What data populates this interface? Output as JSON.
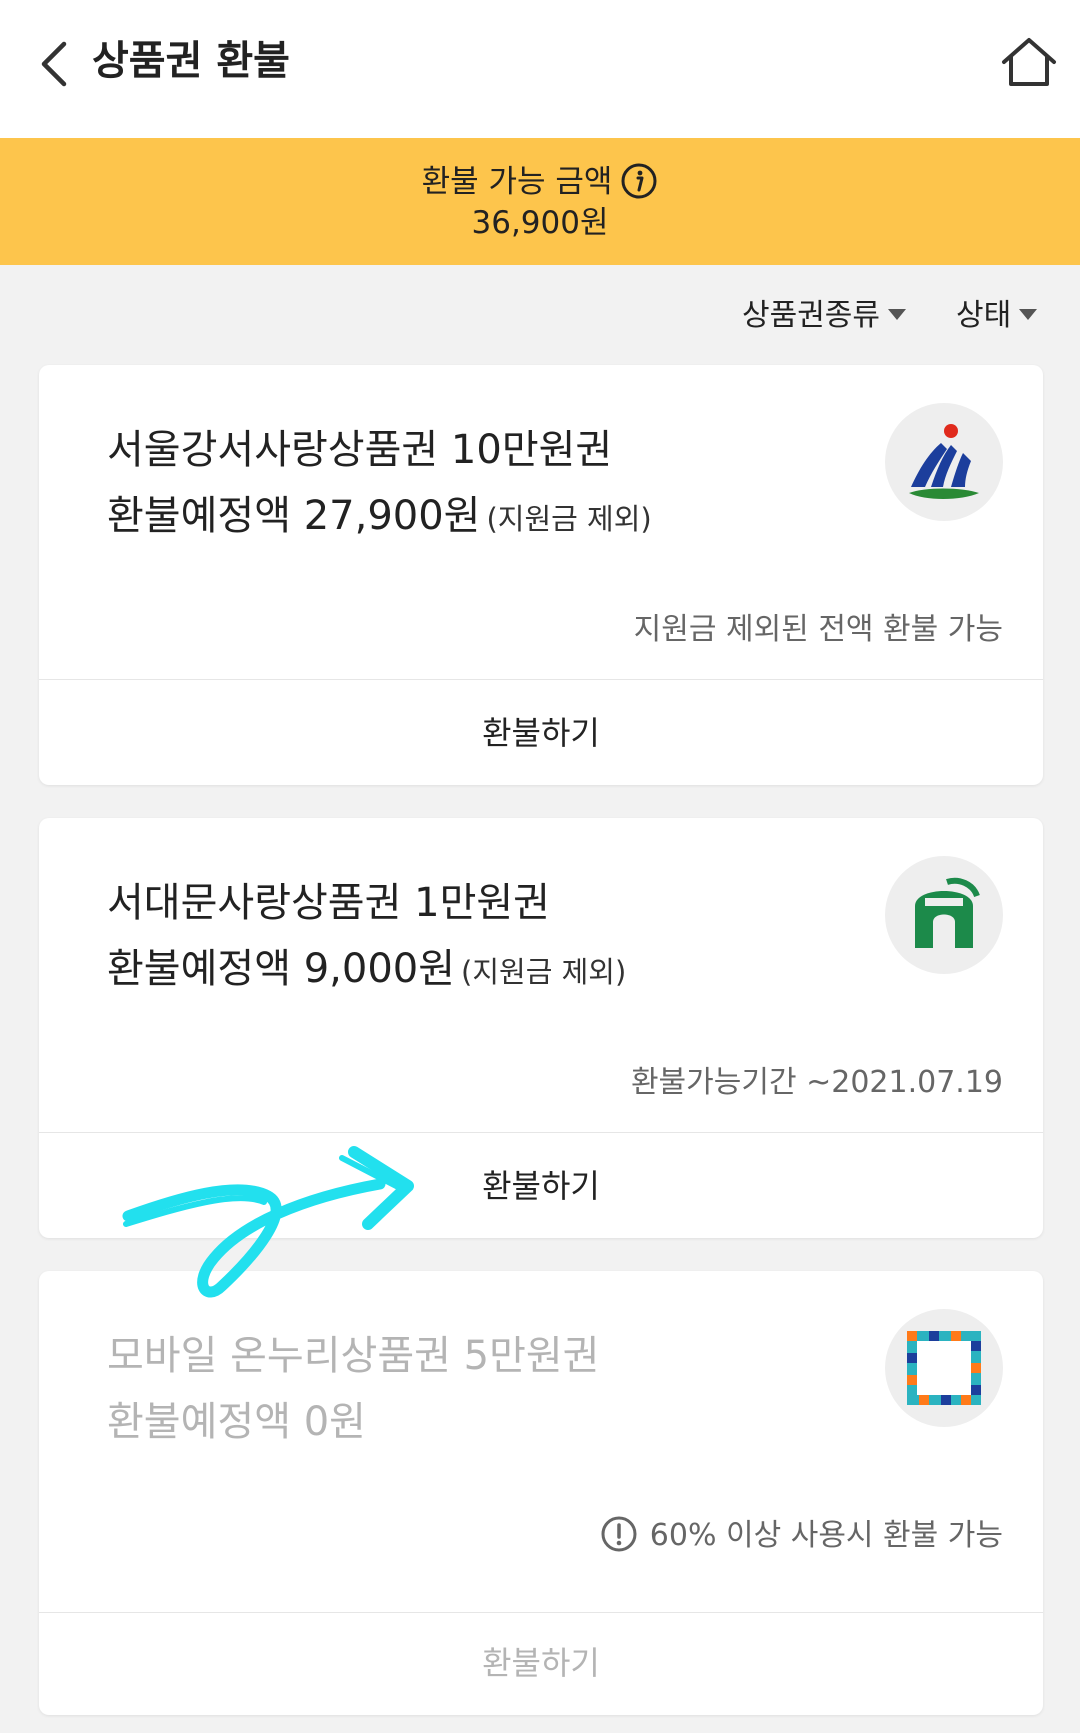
{
  "header": {
    "title": "상품권 환불",
    "back_icon": "chevron-left-icon",
    "home_icon": "home-icon"
  },
  "banner": {
    "label": "환불 가능 금액",
    "amount": "36,900원",
    "info_icon": "info-icon",
    "background_color": "#fdc54c"
  },
  "filters": [
    {
      "label": "상품권종류"
    },
    {
      "label": "상태"
    }
  ],
  "vouchers": [
    {
      "title": "서울강서사랑상품권 10만원권",
      "amount": "환불예정액 27,900원",
      "amount_note": "(지원금 제외)",
      "note": "지원금 제외된 전액 환불 가능",
      "button": "환불하기",
      "logo_icon": "gangseo-logo-icon",
      "enabled": true
    },
    {
      "title": "서대문사랑상품권 1만원권",
      "amount": "환불예정액 9,000원",
      "amount_note": "(지원금 제외)",
      "note": "환불가능기간 ~2021.07.19",
      "button": "환불하기",
      "logo_icon": "seodaemun-logo-icon",
      "enabled": true
    },
    {
      "title": "모바일 온누리상품권 5만원권",
      "amount": "환불예정액 0원",
      "note": "60% 이상 사용시 환불 가능",
      "note_icon": "warning-circle-icon",
      "button": "환불하기",
      "logo_icon": "onnuri-logo-icon",
      "enabled": false
    }
  ],
  "annotation": {
    "icon": "hand-drawn-arrow-icon",
    "color": "#22e0ee"
  }
}
